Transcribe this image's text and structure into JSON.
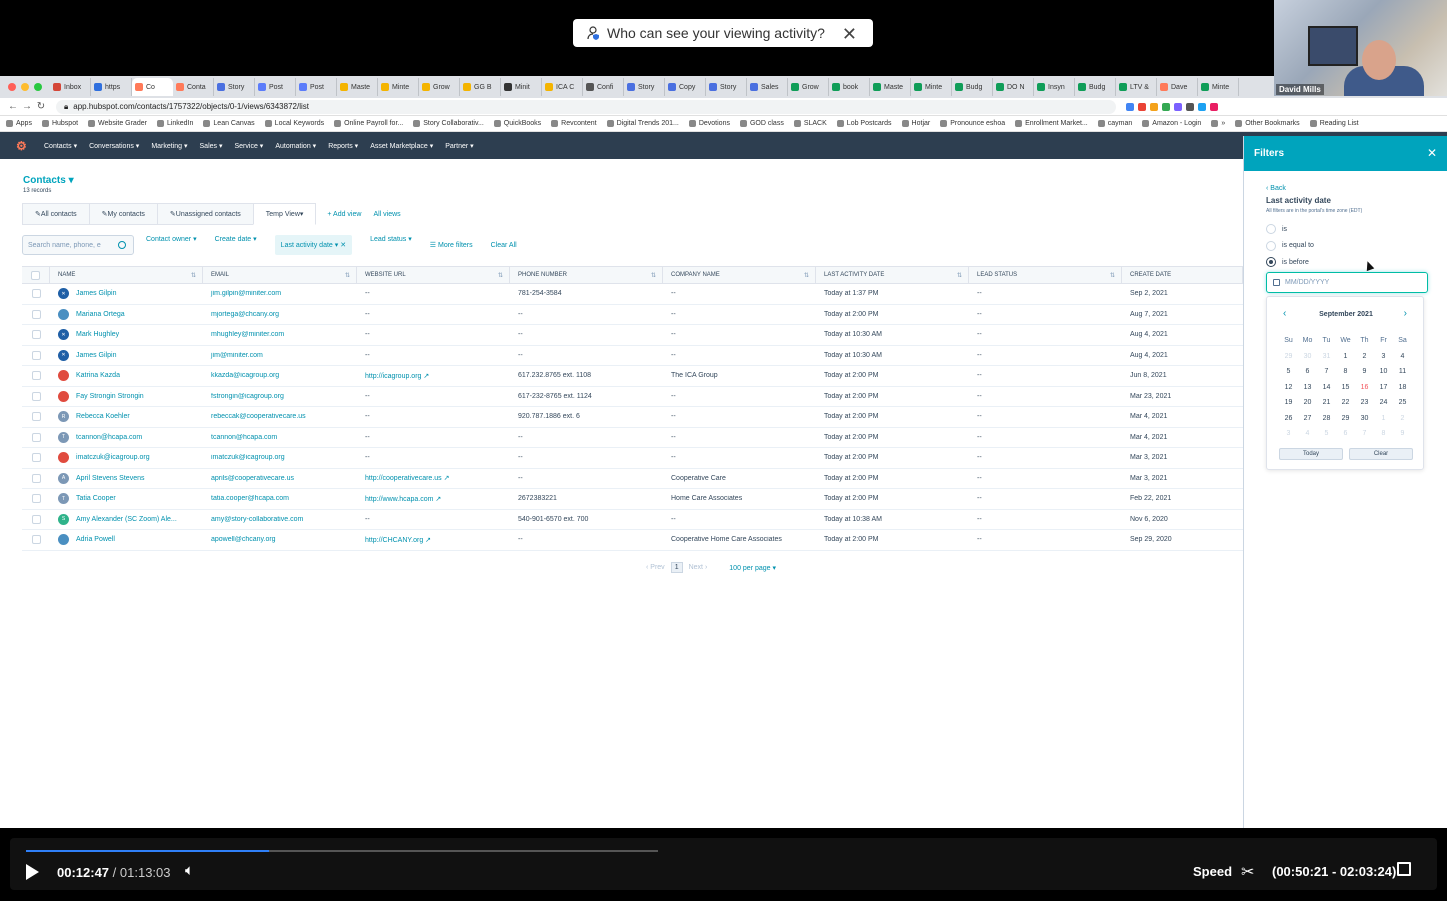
{
  "toast": {
    "text": "Who can see your viewing activity?"
  },
  "browser": {
    "tabs": [
      "Inbox",
      "https",
      "Co",
      "Conta",
      "Story",
      "Post",
      "Post",
      "Maste",
      "Minte",
      "Grow",
      "GG B",
      "Minit",
      "ICA C",
      "Confi",
      "Story",
      "Copy",
      "Story",
      "Sales",
      "Grow",
      "book",
      "Maste",
      "Minte",
      "Budg",
      "DO N",
      "Insyn",
      "Budg",
      "LTV &",
      "Dave",
      "Minte"
    ],
    "url": "app.hubspot.com/contacts/1757322/objects/0-1/views/6343872/list",
    "bookmarks": [
      "Apps",
      "Hubspot",
      "Website Grader",
      "LinkedIn",
      "Lean Canvas",
      "Local Keywords",
      "Online Payroll for...",
      "Story Collaborativ...",
      "QuickBooks",
      "Revcontent",
      "Digital Trends 201...",
      "Devotions",
      "GOD class",
      "SLACK",
      "Lob Postcards",
      "Hotjar",
      "Pronounce eshoa",
      "Enrollment Market...",
      "cayman",
      "Amazon - Login",
      "»",
      "Other Bookmarks",
      "Reading List"
    ]
  },
  "hsnav": {
    "items": [
      "Contacts",
      "Conversations",
      "Marketing",
      "Sales",
      "Service",
      "Automation",
      "Reports",
      "Asset Marketplace",
      "Partner"
    ]
  },
  "page": {
    "title": "Contacts",
    "records": "13 records",
    "views": [
      "All contacts",
      "My contacts",
      "Unassigned contacts",
      "Temp View"
    ],
    "add_view": "+ Add view",
    "all_views": "All views",
    "search_placeholder": "Search name, phone, e",
    "filters": [
      "Contact owner",
      "Create date",
      "Last activity date",
      "Lead status"
    ],
    "more_filters": "More filters",
    "clear_all": "Clear All"
  },
  "table": {
    "headers": [
      "NAME",
      "EMAIL",
      "WEBSITE URL",
      "PHONE NUMBER",
      "COMPANY NAME",
      "LAST ACTIVITY DATE",
      "LEAD STATUS",
      "CREATE DATE"
    ],
    "rows": [
      {
        "name": "James Gilpin",
        "email": "jim.gilpin@miniter.com",
        "url": "--",
        "phone": "781-254-3584",
        "company": "--",
        "last": "Today at 1:37 PM",
        "lead": "--",
        "created": "Sep 2, 2021",
        "av": "#1f5fa6",
        "avt": "✕"
      },
      {
        "name": "Mariana Ortega",
        "email": "mjortega@chcany.org",
        "url": "--",
        "phone": "--",
        "company": "--",
        "last": "Today at 2:00 PM",
        "lead": "--",
        "created": "Aug 7, 2021",
        "av": "#4a8fc1",
        "avt": ""
      },
      {
        "name": "Mark Hughley",
        "email": "mhughley@miniter.com",
        "url": "--",
        "phone": "--",
        "company": "--",
        "last": "Today at 10:30 AM",
        "lead": "--",
        "created": "Aug 4, 2021",
        "av": "#1f5fa6",
        "avt": "✕"
      },
      {
        "name": "James Gilpin",
        "email": "jim@miniter.com",
        "url": "--",
        "phone": "--",
        "company": "--",
        "last": "Today at 10:30 AM",
        "lead": "--",
        "created": "Aug 4, 2021",
        "av": "#1f5fa6",
        "avt": "✕"
      },
      {
        "name": "Katrina Kazda",
        "email": "kkazda@icagroup.org",
        "url": "http://icagroup.org",
        "phone": "617.232.8765 ext. 1108",
        "company": "The ICA Group",
        "last": "Today at 2:00 PM",
        "lead": "--",
        "created": "Jun 8, 2021",
        "av": "#e04b3f",
        "avt": ""
      },
      {
        "name": "Fay Strongin Strongin",
        "email": "fstrongin@icagroup.org",
        "url": "--",
        "phone": "617-232-8765 ext. 1124",
        "company": "--",
        "last": "Today at 2:00 PM",
        "lead": "--",
        "created": "Mar 23, 2021",
        "av": "#e04b3f",
        "avt": ""
      },
      {
        "name": "Rebecca Koehler",
        "email": "rebeccak@cooperativecare.us",
        "url": "--",
        "phone": "920.787.1886 ext. 6",
        "company": "--",
        "last": "Today at 2:00 PM",
        "lead": "--",
        "created": "Mar 4, 2021",
        "av": "#7c98b6",
        "avt": "R"
      },
      {
        "name": "tcannon@hcapa.com",
        "email": "tcannon@hcapa.com",
        "url": "--",
        "phone": "--",
        "company": "--",
        "last": "Today at 2:00 PM",
        "lead": "--",
        "created": "Mar 4, 2021",
        "av": "#7c98b6",
        "avt": "T"
      },
      {
        "name": "imatczuk@icagroup.org",
        "email": "imatczuk@icagroup.org",
        "url": "--",
        "phone": "--",
        "company": "--",
        "last": "Today at 2:00 PM",
        "lead": "--",
        "created": "Mar 3, 2021",
        "av": "#e04b3f",
        "avt": ""
      },
      {
        "name": "April Stevens Stevens",
        "email": "aprils@cooperativecare.us",
        "url": "http://cooperativecare.us",
        "phone": "--",
        "company": "Cooperative Care",
        "last": "Today at 2:00 PM",
        "lead": "--",
        "created": "Mar 3, 2021",
        "av": "#7c98b6",
        "avt": "A"
      },
      {
        "name": "Tatia Cooper",
        "email": "tatia.cooper@hcapa.com",
        "url": "http://www.hcapa.com",
        "phone": "2672383221",
        "company": "Home Care Associates",
        "last": "Today at 2:00 PM",
        "lead": "--",
        "created": "Feb 22, 2021",
        "av": "#7c98b6",
        "avt": "T"
      },
      {
        "name": "Amy Alexander (SC Zoom) Ale...",
        "email": "amy@story-collaborative.com",
        "url": "--",
        "phone": "540-901-6570 ext. 700",
        "company": "--",
        "last": "Today at 10:38 AM",
        "lead": "--",
        "created": "Nov 6, 2020",
        "av": "#2fb38a",
        "avt": "S"
      },
      {
        "name": "Adria Powell",
        "email": "apowell@chcany.org",
        "url": "http://CHCANY.org",
        "phone": "--",
        "company": "Cooperative Home Care Associates",
        "last": "Today at 2:00 PM",
        "lead": "--",
        "created": "Sep 29, 2020",
        "av": "#4a8fc1",
        "avt": ""
      }
    ]
  },
  "pager": {
    "prev": "Prev",
    "page": "1",
    "next": "Next",
    "per_page": "100 per page"
  },
  "panel": {
    "title": "Filters",
    "back": "‹ Back",
    "heading": "Last activity date",
    "note": "All filters are in the portal's time zone (EDT)",
    "options": [
      "is",
      "is equal to",
      "is before"
    ],
    "selected_option": 2,
    "date_placeholder": "MM/DD/YYYY",
    "calendar": {
      "month": "September 2021",
      "dow": [
        "Su",
        "Mo",
        "Tu",
        "We",
        "Th",
        "Fr",
        "Sa"
      ],
      "weeks": [
        [
          "29",
          "30",
          "31",
          "1",
          "2",
          "3",
          "4"
        ],
        [
          "5",
          "6",
          "7",
          "8",
          "9",
          "10",
          "11"
        ],
        [
          "12",
          "13",
          "14",
          "15",
          "16",
          "17",
          "18"
        ],
        [
          "19",
          "20",
          "21",
          "22",
          "23",
          "24",
          "25"
        ],
        [
          "26",
          "27",
          "28",
          "29",
          "30",
          "1",
          "2"
        ],
        [
          "3",
          "4",
          "5",
          "6",
          "7",
          "8",
          "9"
        ]
      ],
      "today": "16",
      "today_label": "Today",
      "clear_label": "Clear"
    }
  },
  "webcam": {
    "name": "David Mills"
  },
  "player": {
    "current": "00:12:47",
    "total": "/ 01:13:03",
    "speed": "Speed",
    "clip": "(00:50:21 - 02:03:24)",
    "progress": 0.385
  }
}
